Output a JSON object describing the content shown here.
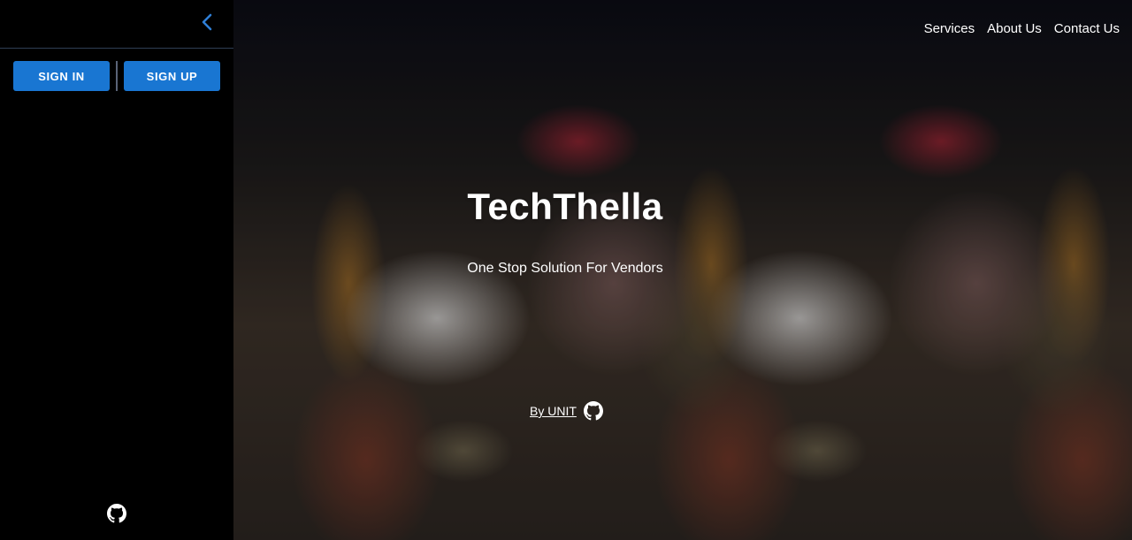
{
  "sidebar": {
    "signin_label": "SIGN IN",
    "signup_label": "SIGN UP"
  },
  "nav": {
    "services": "Services",
    "about": "About Us",
    "contact": "Contact Us"
  },
  "hero": {
    "title": "TechThella",
    "tagline": "One Stop Solution For Vendors",
    "byline": "By UNIT"
  },
  "colors": {
    "primary_button": "#1976d2",
    "chevron": "#2f7fd6",
    "sidebar_bg": "#000000"
  },
  "icons": {
    "collapse": "chevron-left-icon",
    "github": "github-icon"
  }
}
